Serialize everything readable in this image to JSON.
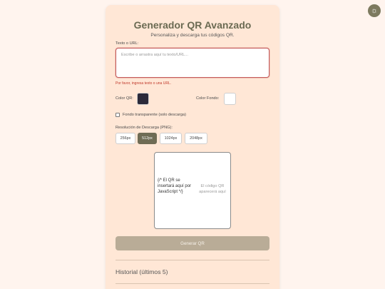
{
  "header": {
    "title": "Generador QR Avanzado",
    "subtitle": "Personaliza y descarga tus códigos QR."
  },
  "input": {
    "label": "Texto o URL:",
    "placeholder": "Escribe o arrastra aquí tu texto/URL...",
    "error": "Por favor, ingresa texto o una URL."
  },
  "colors": {
    "qr_label": "Color QR:",
    "qr_value": "#2b2a3a",
    "bg_label": "Color Fondo:",
    "bg_value": "#ffffff"
  },
  "transparent": {
    "label": "Fondo transparente (solo descarga)",
    "checked": false
  },
  "resolution": {
    "label": "Resolución de Descarga (PNG):",
    "options": [
      "256px",
      "512px",
      "1024px",
      "2048px"
    ],
    "selected": "512px"
  },
  "preview": {
    "comment": "{/* El QR se insertará aquí por JavaScript */}",
    "placeholder": "El código QR aparecerá aquí"
  },
  "generate_label": "Generar QR",
  "history": {
    "title": "Historial (últimos 5)"
  },
  "theme_icon": "sun-icon"
}
